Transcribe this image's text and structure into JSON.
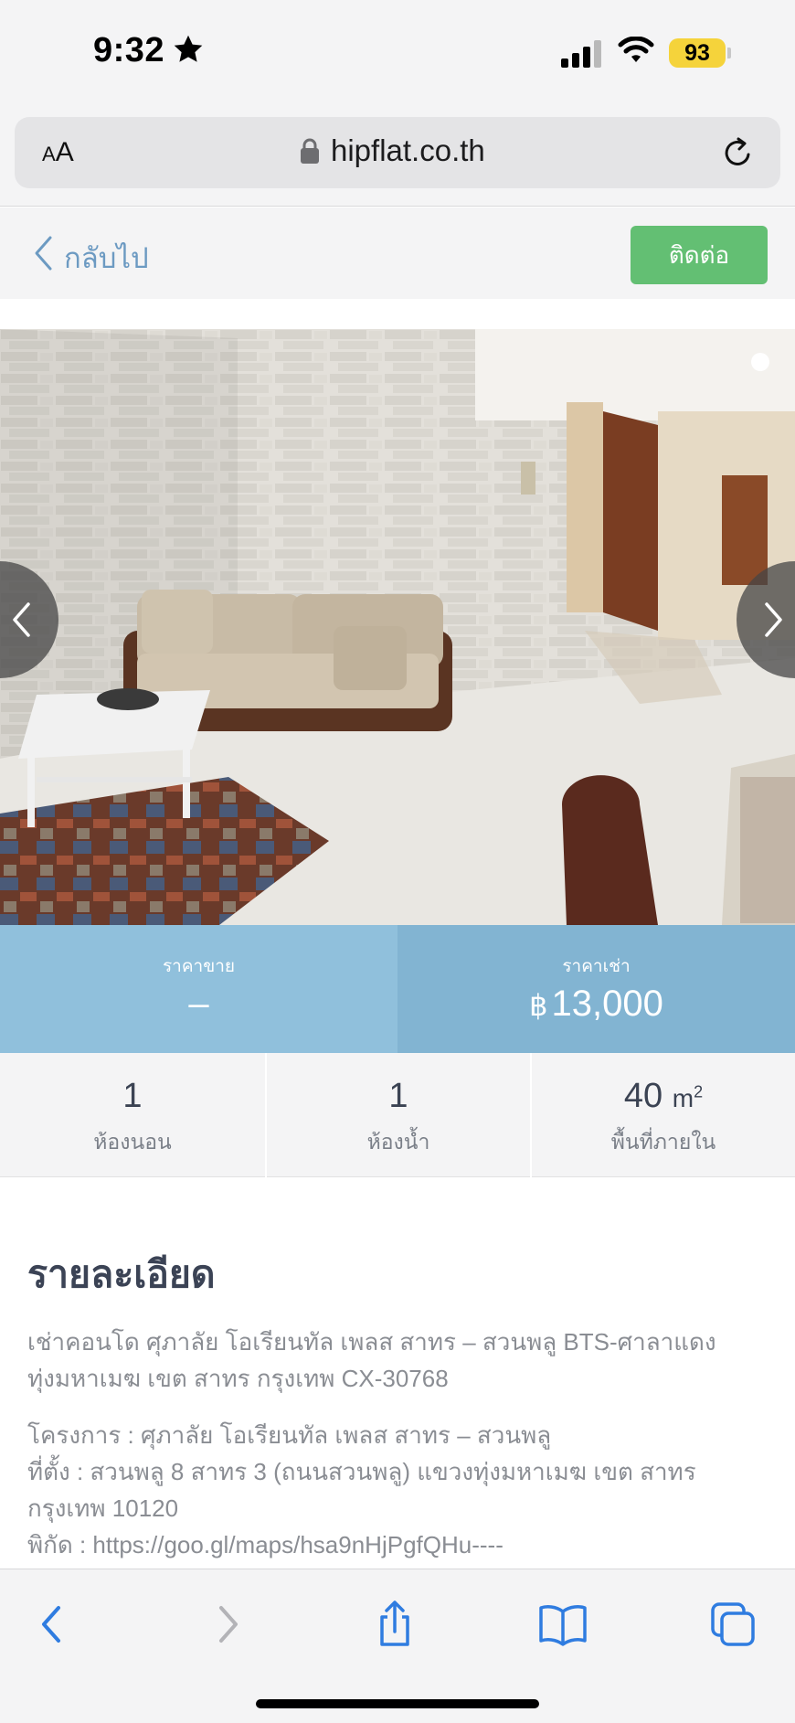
{
  "status_bar": {
    "time": "9:32",
    "battery": "93"
  },
  "browser": {
    "text_size_label_small": "A",
    "text_size_label_large": "A",
    "url": "hipflat.co.th"
  },
  "header": {
    "back_label": "กลับไป",
    "contact_label": "ติดต่อ"
  },
  "prices": {
    "sale": {
      "label": "ราคาขาย",
      "value": "–"
    },
    "rent": {
      "label": "ราคาเช่า",
      "currency": "฿",
      "value": "13,000"
    }
  },
  "stats": [
    {
      "value": "1",
      "label": "ห้องนอน"
    },
    {
      "value": "1",
      "label": "ห้องน้ำ"
    },
    {
      "value": "40",
      "unit": "m",
      "unit_sup": "2",
      "label": "พื้นที่ภายใน"
    }
  ],
  "details": {
    "title": "รายละเอียด",
    "intro": "เช่าคอนโด ศุภาลัย โอเรียนทัล เพลส สาทร – สวนพลู BTS-ศาลาแดง ทุ่งมหาเมฆ เขต สาทร กรุงเทพ CX-30768",
    "project_line": "โครงการ : ศุภาลัย โอเรียนทัล เพลส สาทร – สวนพลู",
    "location_line": "ที่ตั้ง : สวนพลู 8 สาทร 3 (ถนนสวนพลู) แขวงทุ่งมหาเมฆ เขต สาทร กรุงเทพ 10120",
    "coords_line": "พิกัด : https://goo.gl/maps/hsa9nHjPgfQHu----"
  },
  "icons": {
    "star": "star-icon",
    "signal": "signal-icon",
    "wifi": "wifi-icon",
    "lock": "lock-icon",
    "reload": "reload-icon",
    "back": "chevron-left-icon",
    "forward": "chevron-right-icon",
    "share": "share-icon",
    "bookmarks": "book-icon",
    "tabs": "tabs-icon"
  },
  "colors": {
    "accent": "#2f7ce0",
    "contact_button": "#63bf73",
    "sale_panel": "#90c0dc",
    "rent_panel": "#82b4d2",
    "battery": "#f5d33b"
  }
}
